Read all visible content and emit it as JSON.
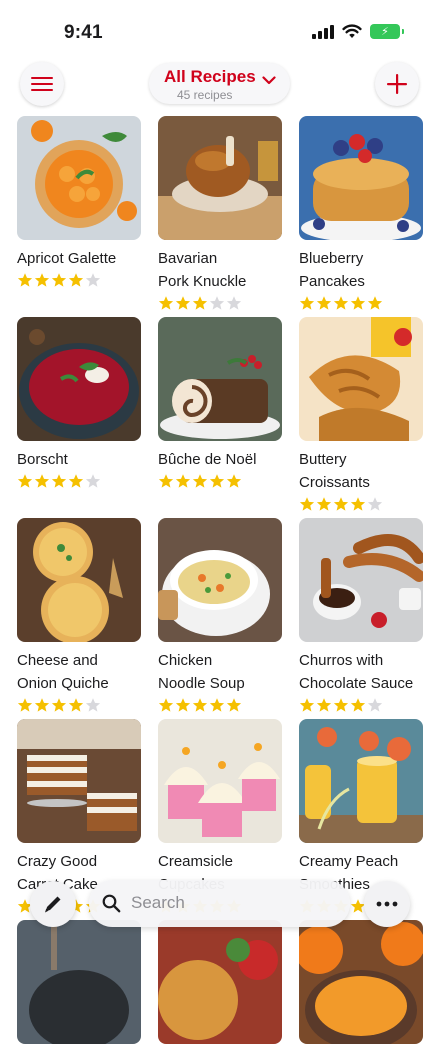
{
  "status_bar": {
    "time": "9:41",
    "battery_icon": "battery-charging-icon",
    "signal_icon": "cellular-signal-icon",
    "wifi_icon": "wifi-icon"
  },
  "header": {
    "title": "All Recipes",
    "subtitle": "45 recipes",
    "menu_icon": "hamburger-menu-icon",
    "add_icon": "plus-icon",
    "dropdown_icon": "chevron-down-icon"
  },
  "colors": {
    "accent": "#d0021b",
    "star_filled": "#f5c000",
    "star_empty": "#d8d8dc"
  },
  "recipes": [
    {
      "name": "Apricot Galette",
      "rating": 4,
      "thumb": "apricot",
      "max_rating": 5
    },
    {
      "name": "Bavarian\nPork Knuckle",
      "rating": 3,
      "thumb": "pork"
    },
    {
      "name": "Blueberry\nPancakes",
      "rating": 5,
      "thumb": "pancakes"
    },
    {
      "name": "Borscht",
      "rating": 4,
      "thumb": "borscht"
    },
    {
      "name": "Bûche de Noël",
      "rating": 5,
      "thumb": "buche"
    },
    {
      "name": "Buttery\nCroissants",
      "rating": 4,
      "thumb": "croissant"
    },
    {
      "name": "Cheese and\nOnion Quiche",
      "rating": 4,
      "thumb": "quiche"
    },
    {
      "name": "Chicken\nNoodle Soup",
      "rating": 5,
      "thumb": "soup"
    },
    {
      "name": "Churros with\nChocolate Sauce",
      "rating": 4,
      "thumb": "churros"
    },
    {
      "name": "Crazy Good\nCarrot Cake",
      "rating": 5,
      "thumb": "carrotcake"
    },
    {
      "name": "Creamsicle\nCupcakes",
      "rating": 5,
      "thumb": "cupcakes"
    },
    {
      "name": "Creamy Peach\nSmoothies",
      "rating": 4,
      "thumb": "smoothie"
    },
    {
      "name": "",
      "rating": 0,
      "thumb": "pan"
    },
    {
      "name": "",
      "rating": 0,
      "thumb": "pie"
    },
    {
      "name": "",
      "rating": 0,
      "thumb": "pumpkinsoup"
    }
  ],
  "bottom_bar": {
    "search_placeholder": "Search",
    "search_icon": "magnifier-icon",
    "edit_icon": "pencil-icon",
    "more_icon": "ellipsis-icon"
  }
}
